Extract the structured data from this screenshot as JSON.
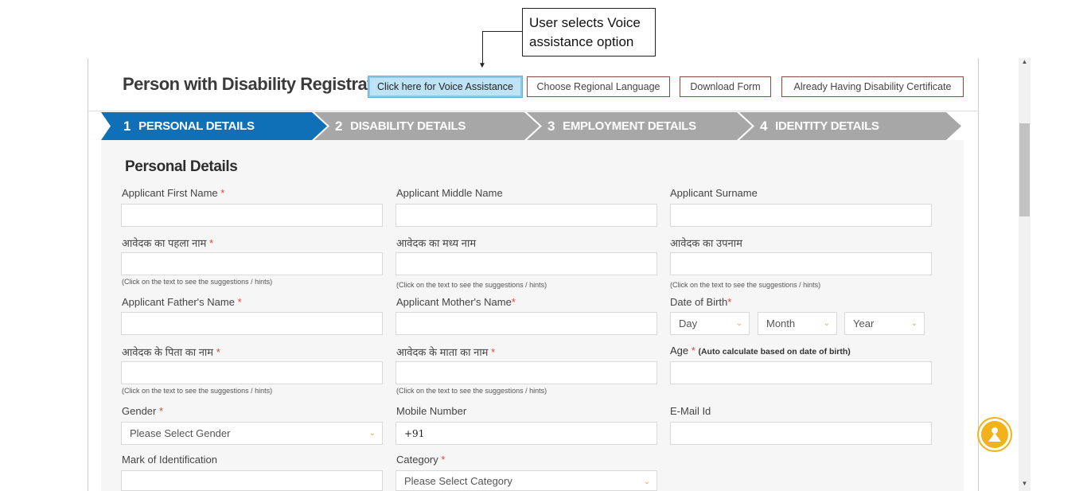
{
  "annotation": {
    "text": "User selects Voice assistance option"
  },
  "header": {
    "title": "Person with Disability Registration",
    "buttons": {
      "voice": "Click here for Voice Assistance",
      "language": "Choose Regional Language",
      "download": "Download Form",
      "certificate": "Already Having Disability Certificate"
    }
  },
  "steps": [
    {
      "num": "1",
      "label": "PERSONAL DETAILS",
      "active": true
    },
    {
      "num": "2",
      "label": "DISABILITY DETAILS",
      "active": false
    },
    {
      "num": "3",
      "label": "EMPLOYMENT DETAILS",
      "active": false
    },
    {
      "num": "4",
      "label": "IDENTITY DETAILS",
      "active": false
    }
  ],
  "colors": {
    "active_step": "#0f6fb7",
    "inactive_step": "#a7a7a7",
    "required": "#e0463a",
    "accent": "#f2b21b"
  },
  "form": {
    "section_title": "Personal Details",
    "required_mark": "*",
    "hint": "(Click on the text to see the suggestions / hints)",
    "fields": {
      "first_name": "Applicant First Name",
      "middle_name": "Applicant Middle Name",
      "surname": "Applicant Surname",
      "first_name_hi": "आवेदक का पहला नाम",
      "middle_name_hi": "आवेदक का मध्य नाम",
      "surname_hi": "आवेदक का उपनाम",
      "father_name": "Applicant Father's Name",
      "mother_name": "Applicant Mother's Name",
      "dob": "Date of Birth",
      "father_name_hi": "आवेदक के पिता का नाम",
      "mother_name_hi": "आवेदक के माता का नाम",
      "age": "Age",
      "age_note": "(Auto calculate based on date of birth)",
      "gender": "Gender",
      "mobile": "Mobile Number",
      "email": "E-Mail Id",
      "mark": "Mark of Identification",
      "category": "Category"
    },
    "dob_selects": {
      "day": "Day",
      "month": "Month",
      "year": "Year"
    },
    "gender_select": "Please Select Gender",
    "mobile_value": "+91",
    "category_select": "Please Select Category"
  },
  "icons": {
    "fab": "user-icon",
    "chevron": "chevron-down-icon"
  }
}
